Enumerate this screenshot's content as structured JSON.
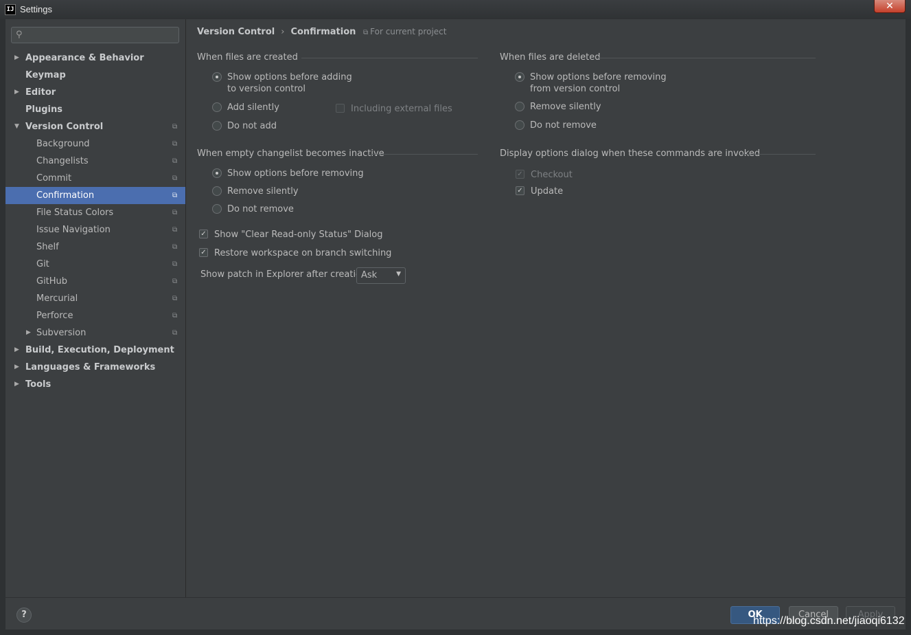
{
  "window": {
    "title": "Settings",
    "app_icon": "IJ",
    "close_symbol": "✕"
  },
  "search": {
    "placeholder": "",
    "icon": "search-icon"
  },
  "sidebar": {
    "items": [
      {
        "label": "Appearance & Behavior",
        "level": 0,
        "expandable": true,
        "expanded": false
      },
      {
        "label": "Keymap",
        "level": 0,
        "expandable": false
      },
      {
        "label": "Editor",
        "level": 0,
        "expandable": true,
        "expanded": false
      },
      {
        "label": "Plugins",
        "level": 0,
        "expandable": false
      },
      {
        "label": "Version Control",
        "level": 0,
        "expandable": true,
        "expanded": true,
        "project": true
      },
      {
        "label": "Background",
        "level": 1,
        "project": true
      },
      {
        "label": "Changelists",
        "level": 1,
        "project": true
      },
      {
        "label": "Commit",
        "level": 1,
        "project": true
      },
      {
        "label": "Confirmation",
        "level": 1,
        "project": true,
        "selected": true
      },
      {
        "label": "File Status Colors",
        "level": 1,
        "project": true
      },
      {
        "label": "Issue Navigation",
        "level": 1,
        "project": true
      },
      {
        "label": "Shelf",
        "level": 1,
        "project": true
      },
      {
        "label": "Git",
        "level": 1,
        "project": true
      },
      {
        "label": "GitHub",
        "level": 1,
        "project": true
      },
      {
        "label": "Mercurial",
        "level": 1,
        "project": true
      },
      {
        "label": "Perforce",
        "level": 1,
        "project": true
      },
      {
        "label": "Subversion",
        "level": 1,
        "project": true,
        "expandable": true,
        "expanded": false
      },
      {
        "label": "Build, Execution, Deployment",
        "level": 0,
        "expandable": true,
        "expanded": false
      },
      {
        "label": "Languages & Frameworks",
        "level": 0,
        "expandable": true,
        "expanded": false
      },
      {
        "label": "Tools",
        "level": 0,
        "expandable": true,
        "expanded": false
      }
    ]
  },
  "breadcrumb": {
    "parent": "Version Control",
    "separator": "›",
    "current": "Confirmation"
  },
  "project_note": "For current project",
  "files_created": {
    "title": "When files are created",
    "opt1_line1": "Show options before adding",
    "opt1_line2": "to version control",
    "opt2": "Add silently",
    "opt3": "Do not add",
    "external": "Including external files",
    "selected": 1
  },
  "files_deleted": {
    "title": "When files are deleted",
    "opt1_line1": "Show options before removing",
    "opt1_line2": "from version control",
    "opt2": "Remove silently",
    "opt3": "Do not remove",
    "selected": 1
  },
  "changelist": {
    "title": "When empty changelist becomes inactive",
    "opt1": "Show options before removing",
    "opt2": "Remove silently",
    "opt3": "Do not remove",
    "selected": 1
  },
  "dialog_cmds": {
    "title": "Display options dialog when these commands are invoked",
    "checkout": "Checkout",
    "checkout_checked": true,
    "checkout_enabled": false,
    "update": "Update",
    "update_checked": true
  },
  "misc": {
    "clear_readonly": "Show \"Clear Read-only Status\" Dialog",
    "clear_readonly_checked": true,
    "restore_workspace": "Restore workspace on branch switching",
    "restore_workspace_checked": true,
    "patch_label": "Show patch in Explorer after creation:",
    "patch_value": "Ask"
  },
  "buttons": {
    "help": "?",
    "ok": "OK",
    "cancel": "Cancel",
    "apply": "Apply"
  },
  "watermark": "https://blog.csdn.net/jiaoqi6132"
}
